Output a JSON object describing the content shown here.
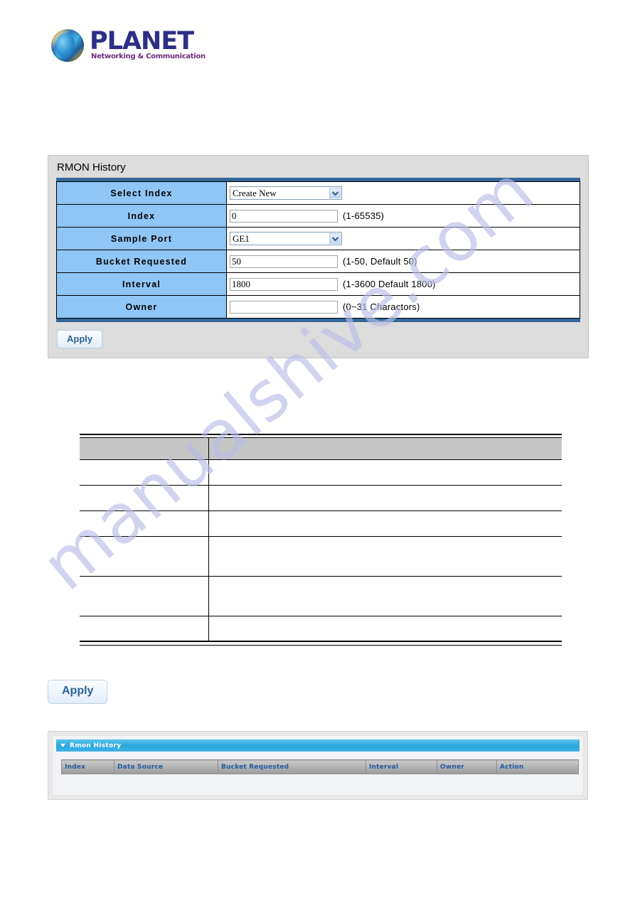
{
  "brand": {
    "logo_icon": "planet-globe-logo-icon",
    "wordmark": "PLANET",
    "tagline": "Networking & Communication"
  },
  "watermark": {
    "text": "manualshive.com"
  },
  "form_panel": {
    "title": "RMON History",
    "rows": [
      {
        "label": "Select Index",
        "control": "select",
        "value": "Create New",
        "options": [
          "Create New"
        ],
        "hint": ""
      },
      {
        "label": "Index",
        "control": "text",
        "value": "0",
        "placeholder": "",
        "hint": "(1-65535)"
      },
      {
        "label": "Sample Port",
        "control": "select",
        "value": "GE1",
        "options": [
          "GE1"
        ],
        "hint": ""
      },
      {
        "label": "Bucket Requested",
        "control": "text",
        "value": "50",
        "placeholder": "",
        "hint": "(1-50, Default 50)"
      },
      {
        "label": "Interval",
        "control": "text",
        "value": "1800",
        "placeholder": "",
        "hint": "(1-3600 Default 1800)"
      },
      {
        "label": "Owner",
        "control": "text",
        "value": "",
        "placeholder": "",
        "hint": "(0~31 Charactors)"
      }
    ],
    "apply_label": "Apply",
    "label_cell_color": "#90c6f5",
    "rule_color": "#336699",
    "panel_bg": "#dcdcdc"
  },
  "description_table": {
    "header": [
      "",
      ""
    ],
    "rows": [
      [
        "",
        ""
      ],
      [
        "",
        ""
      ],
      [
        "",
        ""
      ],
      [
        "",
        ""
      ],
      [
        "",
        ""
      ],
      [
        "",
        ""
      ]
    ],
    "header_bg": "#c6c6c6"
  },
  "apply_button": {
    "label": "Apply"
  },
  "list_panel": {
    "title": "Rmon History",
    "caret_icon": "triangle-down-icon",
    "columns": [
      "Index",
      "Data Source",
      "Bucket Requested",
      "Interval",
      "Owner",
      "Action"
    ],
    "rows": [],
    "title_color": "#ffffff",
    "title_bg": "#2ba6dc",
    "header_text_color": "#2457a0"
  }
}
